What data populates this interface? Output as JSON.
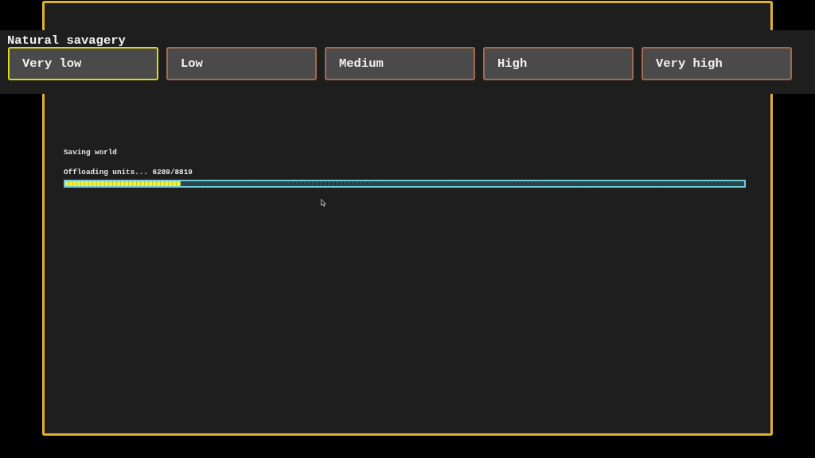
{
  "setting": {
    "label": "Natural savagery",
    "options": [
      {
        "label": "Very low",
        "selected": true
      },
      {
        "label": "Low",
        "selected": false
      },
      {
        "label": "Medium",
        "selected": false
      },
      {
        "label": "High",
        "selected": false
      },
      {
        "label": "Very high",
        "selected": false
      }
    ]
  },
  "progress": {
    "title": "Saving world",
    "status": "Offloading units... 6289/8819",
    "level": 0.17
  }
}
